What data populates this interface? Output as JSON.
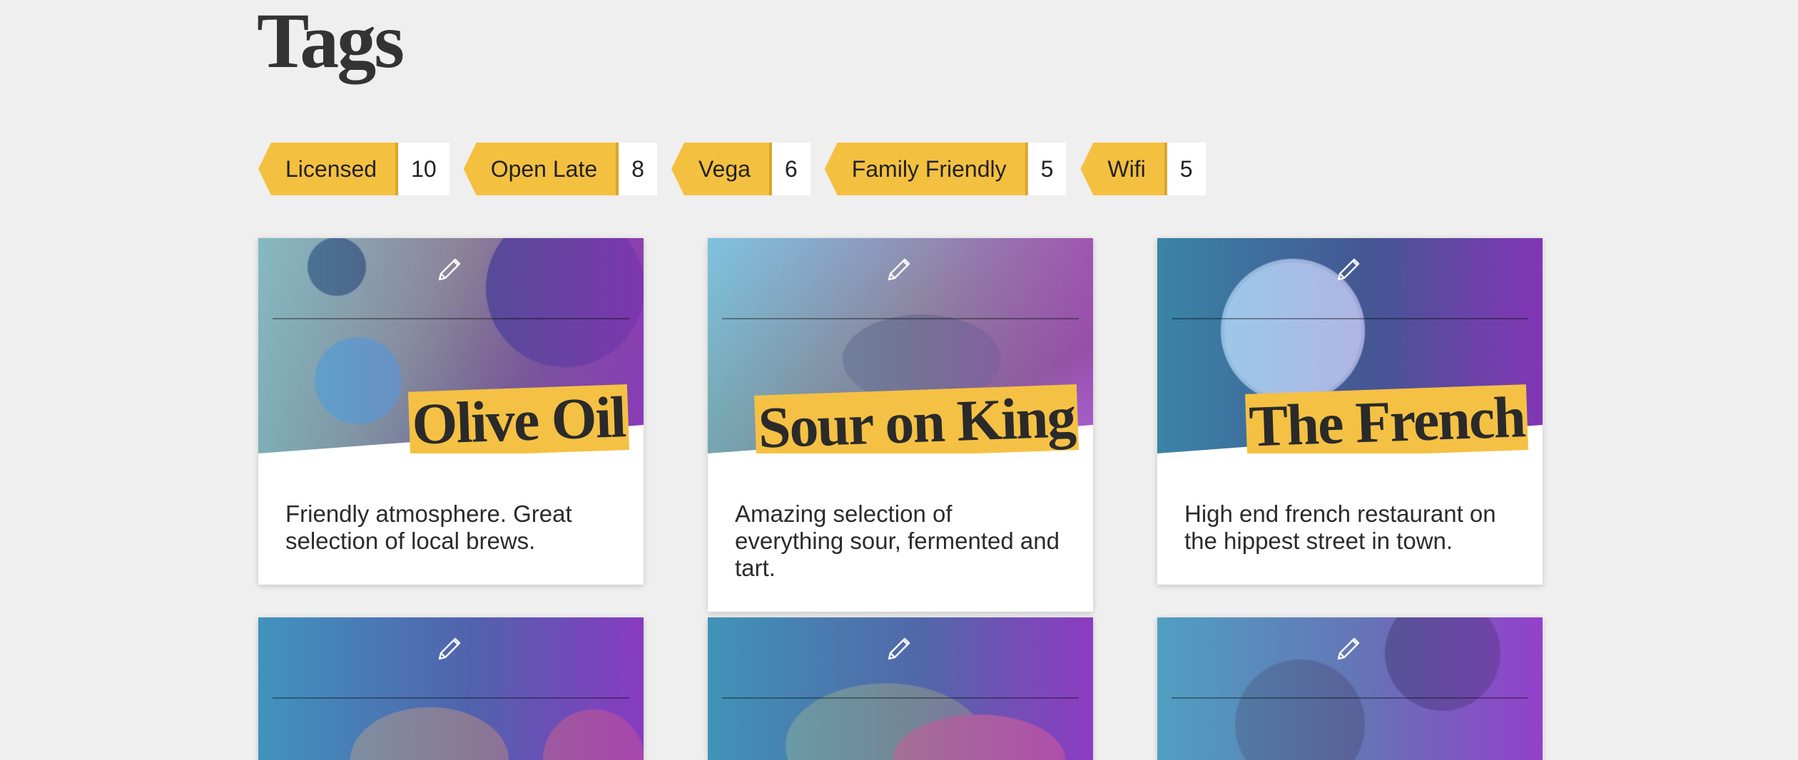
{
  "page": {
    "title": "Tags"
  },
  "tags": [
    {
      "label": "Licensed",
      "count": "10"
    },
    {
      "label": "Open Late",
      "count": "8"
    },
    {
      "label": "Vega",
      "count": "6"
    },
    {
      "label": "Family Friendly",
      "count": "5"
    },
    {
      "label": "Wifi",
      "count": "5"
    }
  ],
  "cards": [
    {
      "title": "Olive Oil",
      "description": "Friendly atmosphere. Great selection of local brews."
    },
    {
      "title": "Sour on King",
      "description": "Amazing selection of everything sour, fermented and tart."
    },
    {
      "title": "The French",
      "description": "High end french restaurant on the hippest street in town."
    },
    {
      "title": "",
      "description": ""
    },
    {
      "title": "",
      "description": ""
    },
    {
      "title": "",
      "description": ""
    }
  ],
  "icons": {
    "edit": "pencil-icon",
    "tag_shape": "tag-label"
  },
  "colors": {
    "background": "#efefef",
    "accent": "#f4c040",
    "text": "#2b2b2b"
  }
}
